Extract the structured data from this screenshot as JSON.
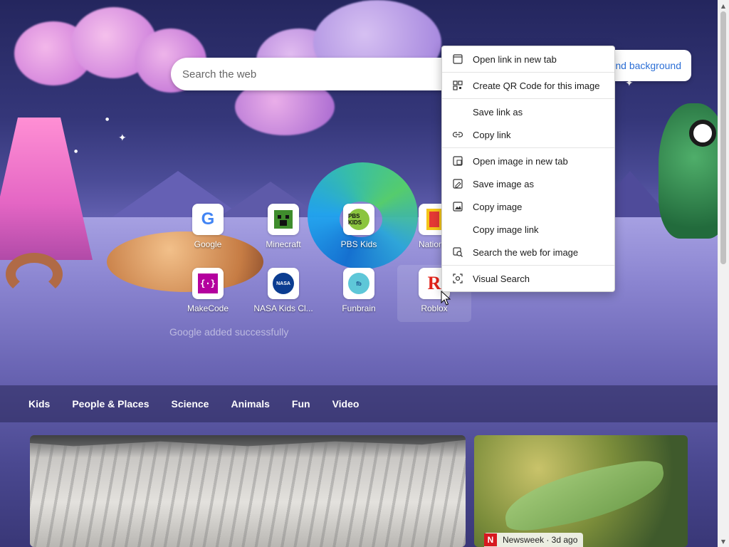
{
  "search": {
    "placeholder": "Search the web"
  },
  "background_button": {
    "label": "nd background"
  },
  "quick_links": [
    {
      "label": "Google",
      "icon": "google-icon"
    },
    {
      "label": "Minecraft",
      "icon": "minecraft-icon"
    },
    {
      "label": "PBS Kids",
      "icon": "pbs-kids-icon",
      "icon_text": "PBS KIDS"
    },
    {
      "label": "National",
      "icon": "national-geographic-icon"
    },
    {
      "label": "MakeCode",
      "icon": "makecode-icon",
      "icon_text": "{·}"
    },
    {
      "label": "NASA Kids Cl...",
      "icon": "nasa-icon",
      "icon_text": "NASA"
    },
    {
      "label": "Funbrain",
      "icon": "funbrain-icon",
      "icon_text": "fb"
    },
    {
      "label": "Roblox",
      "icon": "roblox-icon",
      "icon_text": "R"
    }
  ],
  "toast": {
    "text": "Google added successfully"
  },
  "categories": [
    "Kids",
    "People & Places",
    "Science",
    "Animals",
    "Fun",
    "Video"
  ],
  "cards": [
    {
      "source": "Newsweek · 3d ago",
      "badge": "N"
    }
  ],
  "context_menu": {
    "items": [
      {
        "label": "Open link in new tab",
        "icon": "new-tab-icon"
      },
      {
        "label": "Create QR Code for this image",
        "icon": "qr-code-icon"
      },
      {
        "label": "Save link as",
        "icon": ""
      },
      {
        "label": "Copy link",
        "icon": "link-icon"
      },
      {
        "label": "Open image in new tab",
        "icon": "image-new-tab-icon"
      },
      {
        "label": "Save image as",
        "icon": "save-image-icon"
      },
      {
        "label": "Copy image",
        "icon": "copy-image-icon"
      },
      {
        "label": "Copy image link",
        "icon": ""
      },
      {
        "label": "Search the web for image",
        "icon": "image-search-icon"
      },
      {
        "label": "Visual Search",
        "icon": "visual-search-icon"
      }
    ]
  },
  "colors": {
    "accent_link": "#2c6fd6",
    "menu_bg": "#ffffff",
    "nav_bg": "#2a2858"
  }
}
